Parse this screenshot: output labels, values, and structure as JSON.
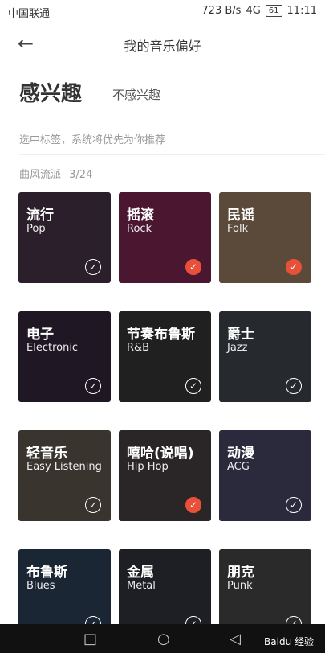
{
  "status": {
    "carrier": "中国联通",
    "speed": "723 B/s",
    "signal": "4G",
    "battery": "61",
    "time": "11:11"
  },
  "header": {
    "title": "我的音乐偏好"
  },
  "tabs": {
    "active": "感兴趣",
    "inactive": "不感兴趣"
  },
  "hint": "选中标签，系统将优先为你推荐",
  "section": {
    "label": "曲风流派",
    "count": "3/24"
  },
  "cards": [
    {
      "zh": "流行",
      "en": "Pop",
      "selected": false,
      "bg": "#2a1f2a"
    },
    {
      "zh": "摇滚",
      "en": "Rock",
      "selected": true,
      "bg": "#4a1630"
    },
    {
      "zh": "民谣",
      "en": "Folk",
      "selected": true,
      "bg": "#5b4a3a"
    },
    {
      "zh": "电子",
      "en": "Electronic",
      "selected": false,
      "bg": "#1f1724"
    },
    {
      "zh": "节奏布鲁斯",
      "en": "R&B",
      "selected": false,
      "bg": "#202020"
    },
    {
      "zh": "爵士",
      "en": "Jazz",
      "selected": false,
      "bg": "#262a2f"
    },
    {
      "zh": "轻音乐",
      "en": "Easy Listening",
      "selected": false,
      "bg": "#3a342e"
    },
    {
      "zh": "嘻哈(说唱)",
      "en": "Hip Hop",
      "selected": true,
      "bg": "#2a2628"
    },
    {
      "zh": "动漫",
      "en": "ACG",
      "selected": false,
      "bg": "#2b2a3d"
    },
    {
      "zh": "布鲁斯",
      "en": "Blues",
      "selected": false,
      "bg": "#1b2635"
    },
    {
      "zh": "金属",
      "en": "Metal",
      "selected": false,
      "bg": "#1d1f24"
    },
    {
      "zh": "朋克",
      "en": "Punk",
      "selected": false,
      "bg": "#2a2a2a"
    }
  ],
  "navbar": {
    "square": "□",
    "circle": "○",
    "triangle": "◁",
    "watermark": "Baidu 经验"
  }
}
